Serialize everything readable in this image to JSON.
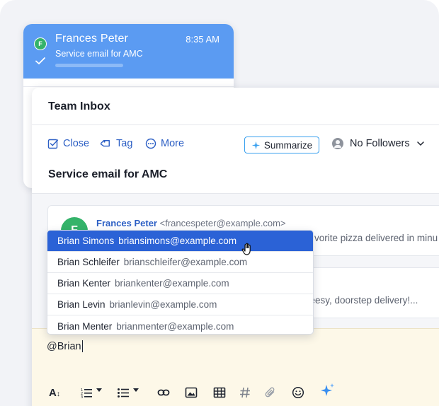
{
  "notification": {
    "avatar_initial": "F",
    "name": "Frances Peter",
    "time": "8:35 AM",
    "subject": "Service email for AMC"
  },
  "inbox": {
    "title": "Team Inbox",
    "toolbar": {
      "close_label": "Close",
      "tag_label": "Tag",
      "more_label": "More",
      "summarize_label": "Summarize",
      "followers_label": "No Followers"
    },
    "subject": "Service email for AMC"
  },
  "thread": {
    "messages": [
      {
        "avatar_initial": "F",
        "sender_name": "Frances Peter",
        "sender_email": "<francespeter@example.com>",
        "preview": "vorite pizza delivered in minu"
      },
      {
        "preview": "heesy, doorstep delivery!..."
      }
    ]
  },
  "mention_dropdown": {
    "items": [
      {
        "name": "Brian Simons",
        "email": "briansimons@example.com"
      },
      {
        "name": "Brian Schleifer",
        "email": "brianschleifer@example.com"
      },
      {
        "name": "Brian Kenter",
        "email": "briankenter@example.com"
      },
      {
        "name": "Brian Levin",
        "email": "brianlevin@example.com"
      },
      {
        "name": "Brian Menter",
        "email": "brianmenter@example.com"
      }
    ],
    "highlighted_index": 0
  },
  "composer": {
    "text": "@Brian"
  },
  "formatting_toolbar": {
    "icons": [
      "text-size-icon",
      "numbered-list-icon",
      "bullet-list-icon",
      "link-icon",
      "image-icon",
      "table-icon",
      "hashtag-icon",
      "attachment-icon",
      "emoji-icon",
      "ai-sparkle-icon"
    ]
  },
  "colors": {
    "accent_blue": "#2b62d6",
    "notification_blue": "#5b9bf2",
    "avatar_green": "#34b36a",
    "composer_bg": "#fdf8e8",
    "summarize_border": "#39a0ef"
  }
}
